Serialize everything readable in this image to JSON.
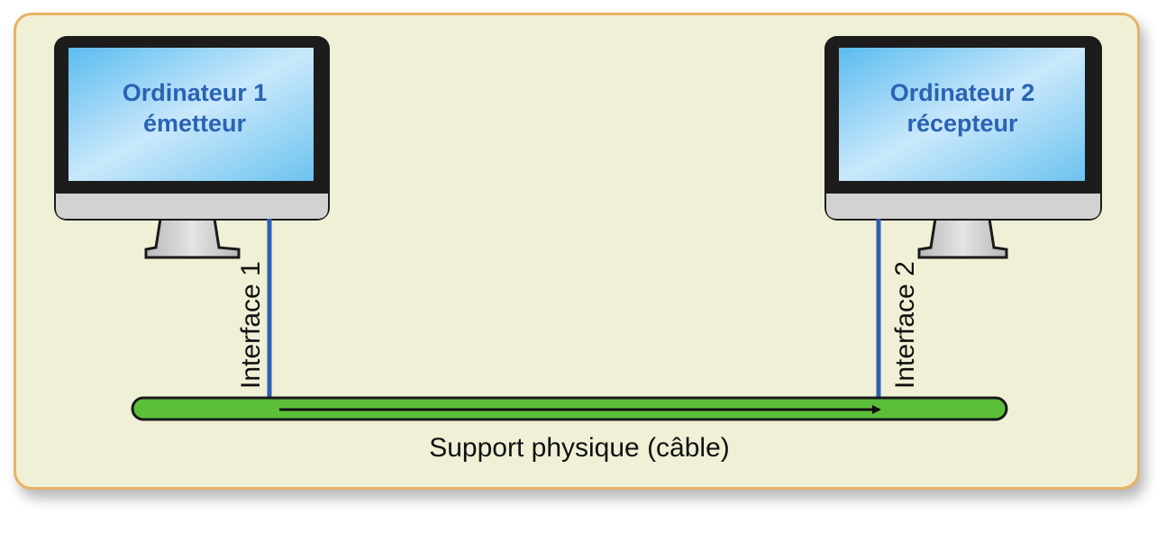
{
  "computer1": {
    "line1": "Ordinateur 1",
    "line2": "émetteur"
  },
  "computer2": {
    "line1": "Ordinateur 2",
    "line2": "récepteur"
  },
  "interface1": "Interface 1",
  "interface2": "Interface 2",
  "support_label": "Support physique (câble)",
  "colors": {
    "panel_bg": "#f0f0d6",
    "panel_border": "#e8b263",
    "screen": "#8fd0f2",
    "screen_text": "#2a63b4",
    "cable": "#5cbf3a",
    "interface_line": "#2f5fb0"
  }
}
